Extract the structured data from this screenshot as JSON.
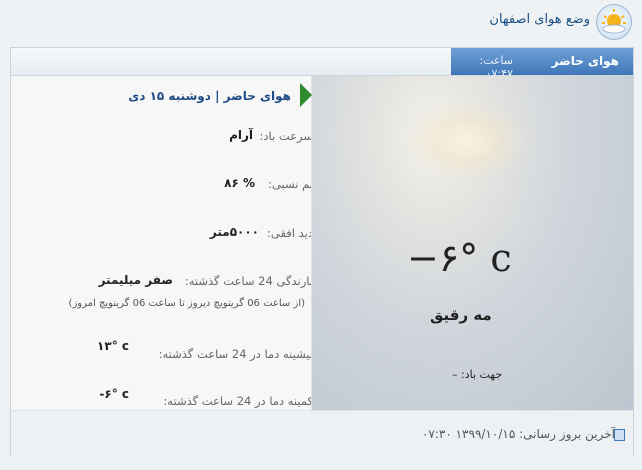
{
  "header": {
    "title": "وضع هوای اصفهان",
    "logo_icon": "sun-cloud-icon"
  },
  "tabs": {
    "active_label": "هوای حاضر",
    "time_label": "ساعت: ۰۷:۴۷"
  },
  "current": {
    "heading": "هوای حاضر | دوشنبه ۱۵ دی",
    "wind_speed_label": "سرعت باد:",
    "wind_speed_value": "آرام",
    "humidity_label": "نم نسبی:",
    "humidity_value": "% ۸۶",
    "visibility_label": "دید افقی:",
    "visibility_value": "۵۰۰۰متر",
    "precip_label": "بارندگی 24 ساعت گذشته:",
    "precip_value": "صفر میلیمتر",
    "precip_note": "(از ساعت 06 گرینویچ دیروز تا ساعت 06 گرینویچ امروز)",
    "max_label": "بیشینه دما در 24 ساعت گذشته:",
    "max_value": "۱۳° c",
    "min_label": "کمینه دما در 24 ساعت گذشته:",
    "min_value": "-۶° c",
    "temperature": "−۶° c",
    "condition": "مه رقیق",
    "wind_direction": "جهت باد: –"
  },
  "footer": {
    "last_update": "آخرین بروز رسانی: ۱۳۹۹/۱۰/۱۵ ۰۷:۳۰",
    "icon": "document-icon"
  },
  "colors": {
    "accent": "#3f76b8",
    "title": "#1e4f86",
    "marker": "#2f8a2f"
  }
}
